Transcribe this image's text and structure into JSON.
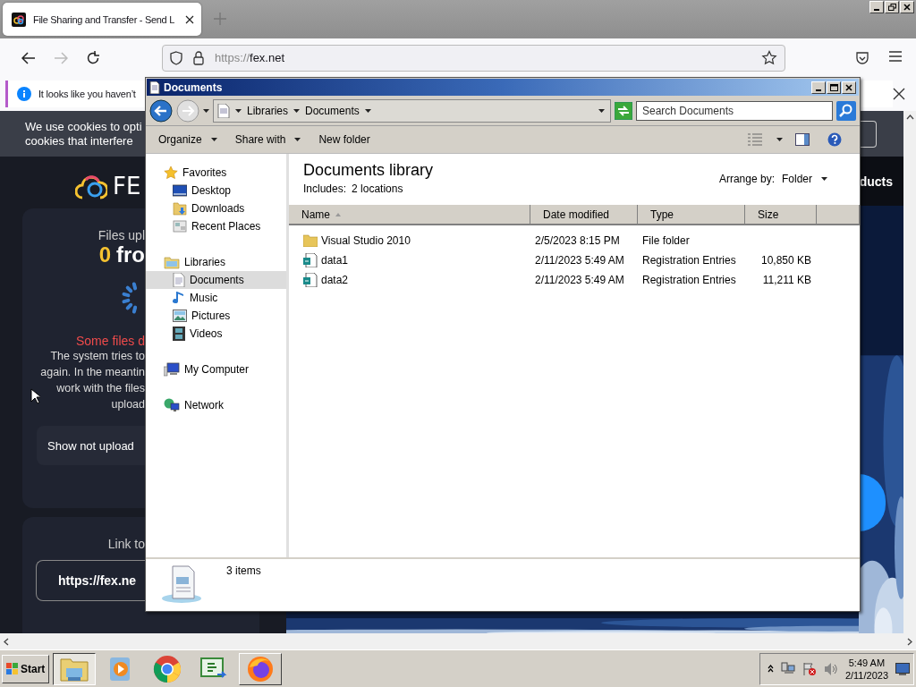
{
  "browser": {
    "tab": {
      "title": "File Sharing and Transfer - Send L",
      "selected": true
    },
    "url": {
      "scheme": "https://",
      "host": "fex.net"
    },
    "notification": "It looks like you haven’t"
  },
  "page": {
    "cookie_lines": [
      "We use cookies to opti",
      "cookies that interfere"
    ],
    "logo": "FE",
    "upload_label": "Files upl",
    "count": "0",
    "count_suffix": "fro",
    "error": "Some files d",
    "message_lines": [
      "The system tries to",
      "again. In the meantin",
      "work with the files",
      "upload"
    ],
    "show_button": "Show not upload",
    "link_label": "Link to",
    "link": "https://fex.ne",
    "nav_item": "ducts"
  },
  "explorer": {
    "title": "Documents",
    "breadcrumb": [
      "Libraries",
      "Documents"
    ],
    "search_placeholder": "Search Documents",
    "commands": [
      {
        "label": "Organize",
        "menu": true
      },
      {
        "label": "Share with",
        "menu": true
      },
      {
        "label": "New folder",
        "menu": false
      }
    ],
    "nav": [
      {
        "label": "Favorites",
        "kind": "star",
        "selected": false,
        "children": [
          {
            "label": "Desktop",
            "kind": "desktop",
            "selected": false
          },
          {
            "label": "Downloads",
            "kind": "downloads",
            "selected": false
          },
          {
            "label": "Recent Places",
            "kind": "recent",
            "selected": false
          }
        ]
      },
      {
        "label": "Libraries",
        "kind": "library",
        "selected": false,
        "children": [
          {
            "label": "Documents",
            "kind": "document",
            "selected": true
          },
          {
            "label": "Music",
            "kind": "music",
            "selected": false
          },
          {
            "label": "Pictures",
            "kind": "pictures",
            "selected": false
          },
          {
            "label": "Videos",
            "kind": "videos",
            "selected": false
          }
        ]
      },
      {
        "label": "My Computer",
        "kind": "computer",
        "selected": false
      },
      {
        "label": "Network",
        "kind": "network",
        "selected": false
      }
    ],
    "library_title": "Documents library",
    "includes_label": "Includes:",
    "includes_value": "2 locations",
    "arrange_label": "Arrange by:",
    "arrange_value": "Folder",
    "columns": [
      "Name",
      "Date modified",
      "Type",
      "Size"
    ],
    "rows": [
      {
        "kind": "folder",
        "name": "Visual Studio 2010",
        "date": "2/5/2023 8:15 PM",
        "type": "File folder"
      },
      {
        "kind": "registry",
        "name": "data1",
        "date": "2/11/2023 5:49 AM",
        "type": "Registration Entries",
        "size": "10,850 KB"
      },
      {
        "kind": "registry",
        "name": "data2",
        "date": "2/11/2023 5:49 AM",
        "type": "Registration Entries",
        "size": "11,211 KB"
      }
    ],
    "status": "3 items"
  },
  "taskbar": {
    "start": "Start",
    "apps": [
      {
        "kind": "explorer",
        "selected": true,
        "open": true
      },
      {
        "kind": "media",
        "selected": false,
        "open": false
      },
      {
        "kind": "chrome",
        "selected": false,
        "open": false
      },
      {
        "kind": "csharp",
        "selected": false,
        "open": false
      },
      {
        "kind": "firefox",
        "selected": false,
        "open": true
      }
    ],
    "time": "5:49 AM",
    "date": "2/11/2023"
  }
}
